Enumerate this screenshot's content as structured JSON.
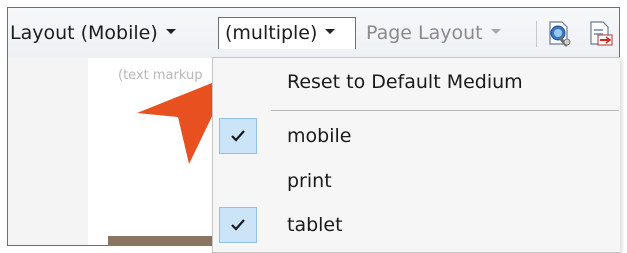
{
  "toolbar": {
    "layout_label": "Layout (Mobile)",
    "medium_label": "(multiple)",
    "page_layout_label": "Page Layout",
    "icons": [
      "preview-icon",
      "compare-icon"
    ]
  },
  "content": {
    "faint_text": "(text markup"
  },
  "menu": {
    "reset_label": "Reset to Default Medium",
    "items": [
      {
        "label": "mobile",
        "checked": true
      },
      {
        "label": "print",
        "checked": false
      },
      {
        "label": "tablet",
        "checked": true
      }
    ]
  },
  "colors": {
    "check_bg": "#cce4f7",
    "check_border": "#91c1ea",
    "cursor_orange": "#e8501f"
  }
}
